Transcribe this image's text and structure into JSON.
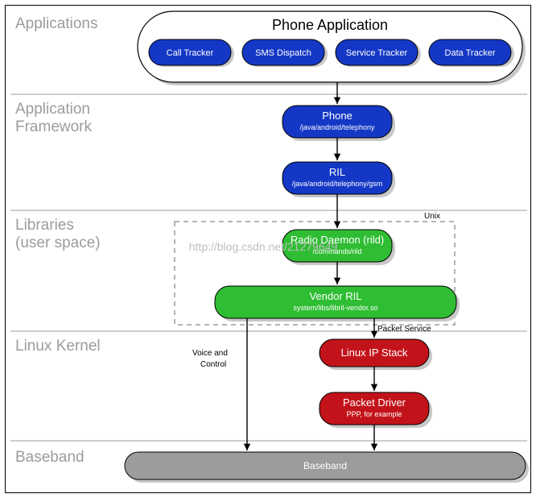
{
  "layers": {
    "applications": "Applications",
    "framework1": "Application",
    "framework2": "Framework",
    "libraries1": "Libraries",
    "libraries2": "(user space)",
    "kernel": "Linux Kernel",
    "baseband": "Baseband"
  },
  "phoneApp": {
    "title": "Phone Application",
    "items": [
      "Call Tracker",
      "SMS Dispatch",
      "Service Tracker",
      "Data Tracker"
    ]
  },
  "framework": {
    "phone": {
      "title": "Phone",
      "sub": "/java/android/telephony"
    },
    "ril": {
      "title": "RIL",
      "sub": "/java/android/telephony/gsm"
    }
  },
  "libraries": {
    "unixLabel": "Unix",
    "rild": {
      "title": "Radio Daemon (rild)",
      "sub": "/commands/rild"
    },
    "vendor": {
      "title": "Vendor RIL",
      "sub": "system/libs/libril-vendor.so"
    }
  },
  "kernel": {
    "packetServiceLabel": "Packet Service",
    "voiceLabel1": "Voice and",
    "voiceLabel2": "Control",
    "ipStack": {
      "title": "Linux IP Stack"
    },
    "pktDriver": {
      "title": "Packet Driver",
      "sub": "PPP, for example"
    }
  },
  "baseband": {
    "title": "Baseband"
  },
  "watermark": "http://blog.csdn.net/21279649",
  "colors": {
    "blue": "#1438c5",
    "green": "#2fbd33",
    "red": "#c3131a",
    "gray": "#9c9c9c",
    "shadow": "#c8c8c8"
  }
}
